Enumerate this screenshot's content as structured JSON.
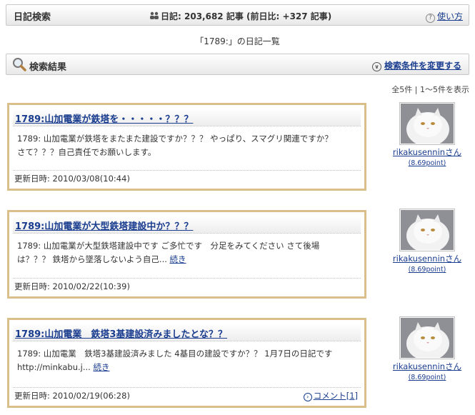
{
  "header": {
    "title": "日記検索",
    "stats_label": "日記:",
    "stats_count": "203,682",
    "stats_unit": "記事",
    "stats_diff": "(前日比: +327 記事)",
    "help_label": "使い方"
  },
  "list_title": "「1789:」の日記一覧",
  "section": {
    "label": "検索結果",
    "change_link": "検索条件を変更する"
  },
  "result_count": "全5件 | 1～5件を表示",
  "entries": [
    {
      "title": "1789:山加電業が鉄塔を・・・・・？？？",
      "body_line1": "1789: 山加電業が鉄塔をまたまた建設ですか？？？ やっぱり、スマグリ関連ですか？",
      "body_line2": "さて？？？自己責任でお願いします。",
      "more": "",
      "date": "更新日時: 2010/03/08(10:44)",
      "comment": "",
      "user": "rikakusenninさん",
      "points": "(8.69point)"
    },
    {
      "title": "1789:山加電業が大型鉄塔建設中か？？？",
      "body_line1": "1789: 山加電業が大型鉄塔建設中です ご多忙です　分足をみてください さて後場",
      "body_line2": "は？？？ 鉄塔から墜落しないよう自己...",
      "more": "続き",
      "date": "更新日時: 2010/02/22(10:39)",
      "comment": "",
      "user": "rikakusenninさん",
      "points": "(8.69point)"
    },
    {
      "title": "1789:山加電業　鉄塔3基建設済みましたとな？？",
      "body_line1": "1789: 山加電業　鉄塔3基建設済みました 4基目の建設ですか？？ 1月7日の日記です",
      "body_line2": "http://minkabu.j...",
      "more": "続き",
      "date": "更新日時: 2010/02/19(06:28)",
      "comment": "コメント[1]",
      "user": "rikakusenninさん",
      "points": "(8.69point)"
    }
  ],
  "colors": {
    "card_border": "#dbbf8b",
    "link": "#1a3d8f"
  },
  "icons": {
    "stats": "people-icon",
    "help": "question-circle-icon",
    "search": "magnifier-icon",
    "change": "chevron-circle-icon",
    "comment": "arrow-circle-icon"
  }
}
